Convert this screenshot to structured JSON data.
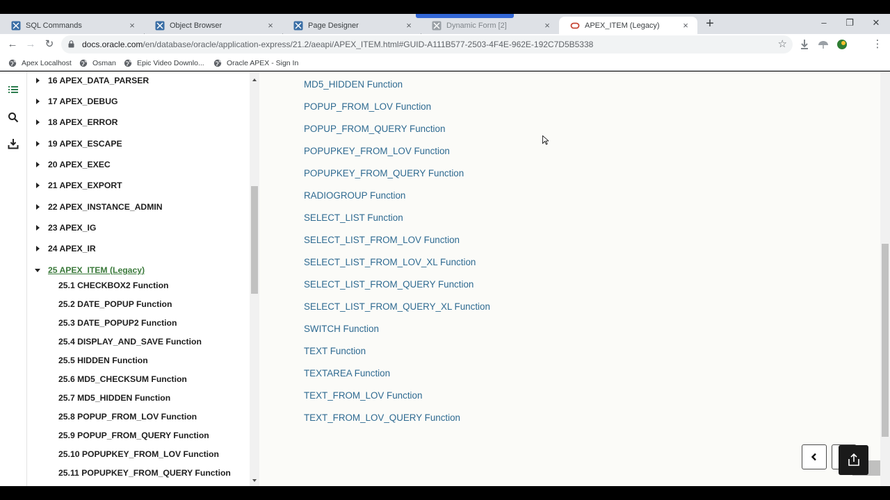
{
  "tabs": [
    {
      "title": "SQL Commands",
      "active": false
    },
    {
      "title": "Object Browser",
      "active": false
    },
    {
      "title": "Page Designer",
      "active": false
    },
    {
      "title": "Dynamic Form [2]",
      "active": false
    },
    {
      "title": "APEX_ITEM (Legacy)",
      "active": true
    }
  ],
  "tab_close_glyph": "×",
  "new_tab_glyph": "+",
  "window_controls": {
    "minimize": "–",
    "restore": "❐",
    "close": "✕"
  },
  "toolbar": {
    "back": "←",
    "forward": "→",
    "reload": "↻",
    "star": "☆",
    "menu": "⋮",
    "url_host": "docs.oracle.com",
    "url_path": "/en/database/oracle/application-express/21.2/aeapi/APEX_ITEM.html#GUID-A111B577-2503-4F4E-962E-192C7D5B5338"
  },
  "bookmarks": [
    "Apex Localhost",
    "Osman",
    "Epic Video Downlo...",
    "Oracle APEX - Sign In"
  ],
  "toc": {
    "chapters": [
      "16 APEX_DATA_PARSER",
      "17 APEX_DEBUG",
      "18 APEX_ERROR",
      "19 APEX_ESCAPE",
      "20 APEX_EXEC",
      "21 APEX_EXPORT",
      "22 APEX_INSTANCE_ADMIN",
      "23 APEX_IG",
      "24 APEX_IR"
    ],
    "active_chapter": "25 APEX_ITEM (Legacy)",
    "sections": [
      "25.1 CHECKBOX2 Function",
      "25.2 DATE_POPUP Function",
      "25.3 DATE_POPUP2 Function",
      "25.4 DISPLAY_AND_SAVE Function",
      "25.5 HIDDEN Function",
      "25.6 MD5_CHECKSUM Function",
      "25.7 MD5_HIDDEN Function",
      "25.8 POPUP_FROM_LOV Function",
      "25.9 POPUP_FROM_QUERY Function",
      "25.10 POPUPKEY_FROM_LOV Function",
      "25.11 POPUPKEY_FROM_QUERY Function"
    ]
  },
  "content": {
    "links": [
      "MD5_HIDDEN Function",
      "POPUP_FROM_LOV Function",
      "POPUP_FROM_QUERY Function",
      "POPUPKEY_FROM_LOV Function",
      "POPUPKEY_FROM_QUERY Function",
      "RADIOGROUP Function",
      "SELECT_LIST Function",
      "SELECT_LIST_FROM_LOV Function",
      "SELECT_LIST_FROM_LOV_XL Function",
      "SELECT_LIST_FROM_QUERY Function",
      "SELECT_LIST_FROM_QUERY_XL Function",
      "SWITCH Function",
      "TEXT Function",
      "TEXTAREA Function",
      "TEXT_FROM_LOV Function",
      "TEXT_FROM_LOV_QUERY Function"
    ]
  },
  "colors": {
    "link": "#2e6a91",
    "active_chapter": "#3b7a3b",
    "tab_accent": "#3367d6"
  },
  "icons": [
    "apex-favicon",
    "oracle-favicon",
    "lock-icon",
    "globe-icon",
    "toc-icon",
    "search-icon",
    "download-icon",
    "caret-right-icon",
    "caret-down-icon",
    "chevron-left-icon",
    "share-icon"
  ]
}
